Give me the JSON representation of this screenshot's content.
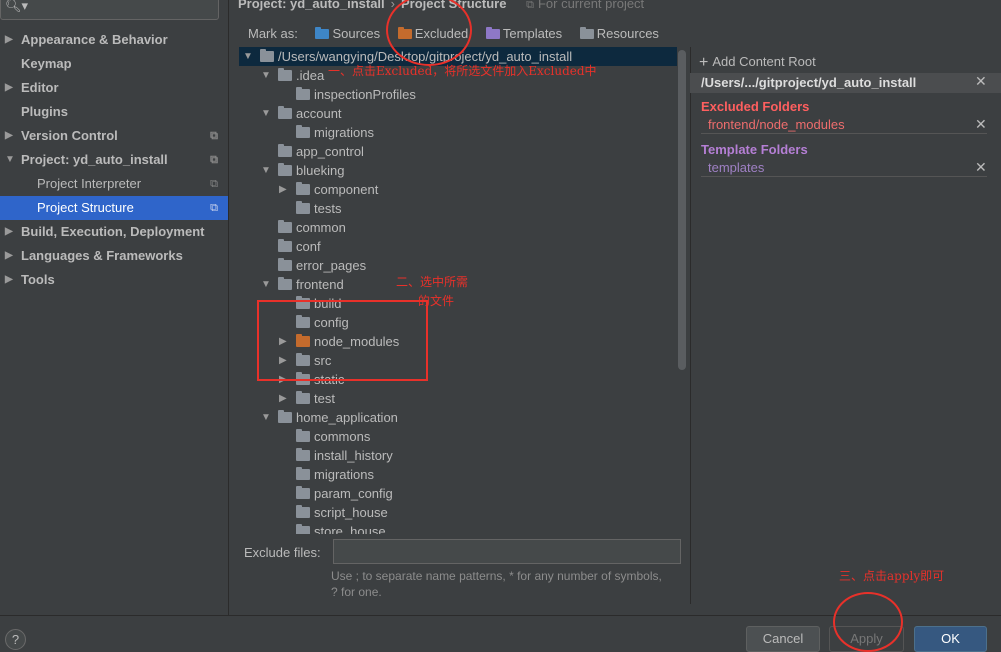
{
  "sidebar": {
    "search_icon": "search-icon",
    "items": [
      {
        "label": "Appearance & Behavior"
      },
      {
        "label": "Keymap"
      },
      {
        "label": "Editor"
      },
      {
        "label": "Plugins"
      },
      {
        "label": "Version Control"
      },
      {
        "label": "Project: yd_auto_install"
      },
      {
        "label": "Project Interpreter"
      },
      {
        "label": "Project Structure"
      },
      {
        "label": "Build, Execution, Deployment"
      },
      {
        "label": "Languages & Frameworks"
      },
      {
        "label": "Tools"
      }
    ]
  },
  "header": {
    "project": "Project: yd_auto_install",
    "separator": "›",
    "page": "Project Structure",
    "hint": "For current project"
  },
  "markbar": {
    "label": "Mark as:",
    "sources": "Sources",
    "excluded": "Excluded",
    "templates": "Templates",
    "resources": "Resources"
  },
  "tree": {
    "rows": [
      {
        "name": "/Users/wangying/Desktop/gitproject/yd_auto_install"
      },
      {
        "name": ".idea"
      },
      {
        "name": "inspectionProfiles"
      },
      {
        "name": "account"
      },
      {
        "name": "migrations"
      },
      {
        "name": "app_control"
      },
      {
        "name": "blueking"
      },
      {
        "name": "component"
      },
      {
        "name": "tests"
      },
      {
        "name": "common"
      },
      {
        "name": "conf"
      },
      {
        "name": "error_pages"
      },
      {
        "name": "frontend"
      },
      {
        "name": "build"
      },
      {
        "name": "config"
      },
      {
        "name": "node_modules"
      },
      {
        "name": "src"
      },
      {
        "name": "static"
      },
      {
        "name": "test"
      },
      {
        "name": "home_application"
      },
      {
        "name": "commons"
      },
      {
        "name": "install_history"
      },
      {
        "name": "migrations"
      },
      {
        "name": "param_config"
      },
      {
        "name": "script_house"
      },
      {
        "name": "store_house"
      }
    ]
  },
  "exclude": {
    "label": "Exclude files:",
    "value": "",
    "hint": "Use ; to separate name patterns, * for any number of symbols, ? for one."
  },
  "content_root": {
    "add_label": "Add Content Root",
    "path": "/Users/.../gitproject/yd_auto_install",
    "excluded_title": "Excluded Folders",
    "excluded_items": [
      "frontend/node_modules"
    ],
    "template_title": "Template Folders",
    "template_items": [
      "templates"
    ]
  },
  "buttons": {
    "help": "?",
    "cancel": "Cancel",
    "apply": "Apply",
    "ok": "OK"
  },
  "annotations": {
    "step1": "一、点击Excluded，将所选文件加入Excluded中",
    "step2_line1": "二、选中所需",
    "step2_line2": "的文件",
    "step3": "三、点击apply即可"
  },
  "colors": {
    "selection": "#2f65ca",
    "excluded_title": "#ff5f5f",
    "excluded_text": "#ee6d6d",
    "template_title": "#b57fd5",
    "template_text": "#9f80c4",
    "excluded_folder": "#c46b2d",
    "sources_folder": "#3e86c7",
    "templates_folder": "#8e78c7",
    "annotation": "#e8312a"
  }
}
